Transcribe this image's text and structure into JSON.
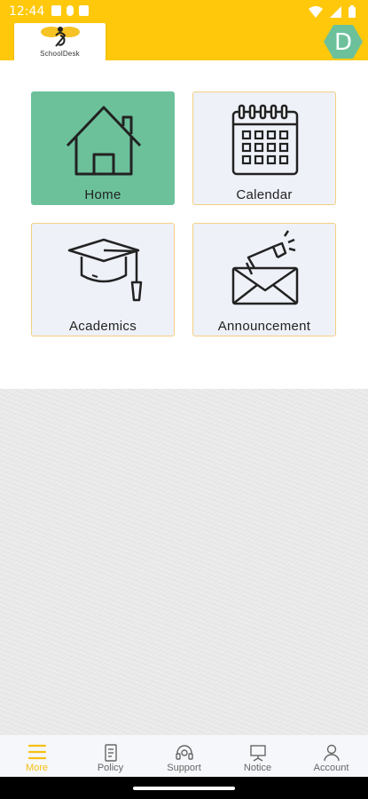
{
  "status_bar": {
    "time": "12:44"
  },
  "header": {
    "logo_text": "SchoolDesk",
    "avatar_letter": "D",
    "brand_color": "#ffc80a",
    "avatar_color": "#6cc19b"
  },
  "tiles": [
    {
      "label": "Home",
      "icon": "house-icon",
      "active": true
    },
    {
      "label": "Calendar",
      "icon": "calendar-icon",
      "active": false
    },
    {
      "label": "Academics",
      "icon": "graduation-cap-icon",
      "active": false
    },
    {
      "label": "Announcement",
      "icon": "megaphone-envelope-icon",
      "active": false
    }
  ],
  "bottom_nav": [
    {
      "label": "More",
      "icon": "menu-icon",
      "active": true
    },
    {
      "label": "Policy",
      "icon": "document-icon",
      "active": false
    },
    {
      "label": "Support",
      "icon": "headset-icon",
      "active": false
    },
    {
      "label": "Notice",
      "icon": "notice-board-icon",
      "active": false
    },
    {
      "label": "Account",
      "icon": "user-icon",
      "active": false
    }
  ],
  "colors": {
    "active_tile": "#6cc19b",
    "tile_bg": "#eef1f8",
    "tile_border": "#f4cf83",
    "nav_active": "#f7c013"
  }
}
